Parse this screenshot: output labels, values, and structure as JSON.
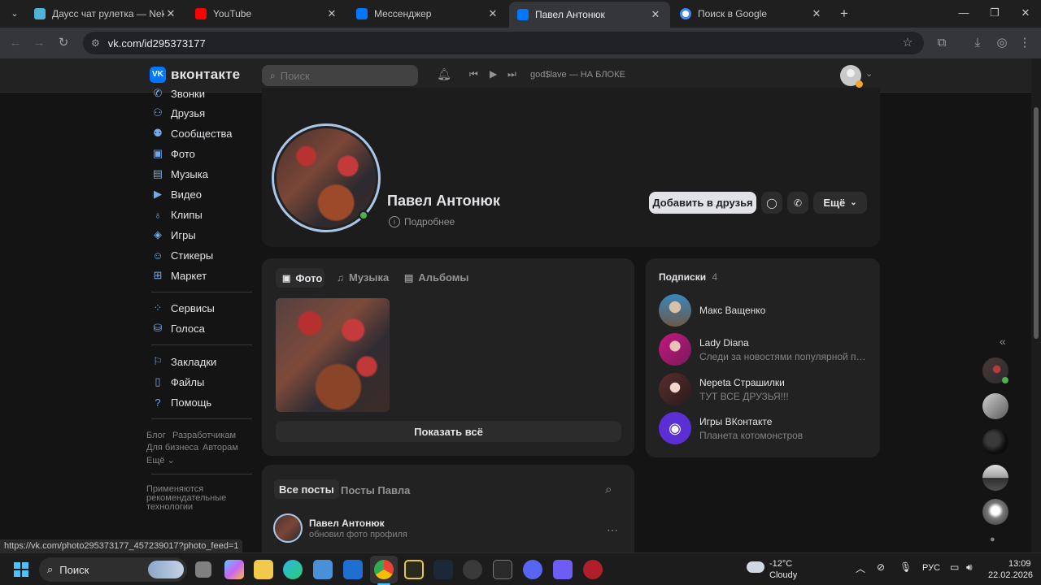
{
  "browser": {
    "tabs": [
      {
        "title": "Даусс чат рулетка — Nekto",
        "color": "#4fb3d9"
      },
      {
        "title": "YouTube",
        "color": "#ff0000"
      },
      {
        "title": "Мессенджер",
        "color": "#0077ff"
      },
      {
        "title": "Павел Антонюк",
        "color": "#0077ff"
      },
      {
        "title": "Поиск в Google",
        "color": "#4285f4"
      }
    ],
    "url": "vk.com/id295373177",
    "status_url": "https://vk.com/photo295373177_457239017?photo_feed=1"
  },
  "vk": {
    "logo_text": "вконтакте",
    "search_placeholder": "Поиск",
    "player_track": "god$lave — НА БЛОКЕ"
  },
  "menu": {
    "items": [
      "Звонки",
      "Друзья",
      "Сообщества",
      "Фото",
      "Музыка",
      "Видео",
      "Клипы",
      "Игры",
      "Стикеры",
      "Маркет"
    ],
    "items2": [
      "Сервисы",
      "Голоса"
    ],
    "items3": [
      "Закладки",
      "Файлы",
      "Помощь"
    ],
    "footer": {
      "blog": "Блог",
      "developers": "Разработчикам",
      "business": "Для бизнеса",
      "authors": "Авторам",
      "more": "Ещё",
      "recommend_1": "Применяются",
      "recommend_2": "рекомендательные",
      "recommend_3": "технологии"
    }
  },
  "profile": {
    "name": "Павел Антонюк",
    "more_info": "Подробнее",
    "add_friend": "Добавить в друзья",
    "more": "Ещё"
  },
  "media": {
    "tabs": [
      "Фото",
      "Музыка",
      "Альбомы"
    ],
    "show_all": "Показать всё"
  },
  "subscriptions": {
    "title": "Подписки",
    "count": "4",
    "items": [
      {
        "name": "Макс Ващенко",
        "desc": ""
      },
      {
        "name": "Lady Diana",
        "desc": "Следи за новостями популярной певи..."
      },
      {
        "name": "Nepeta Страшилки",
        "desc": "ТУТ ВСЕ ДРУЗЬЯ!!!"
      },
      {
        "name": "Игры ВКонтакте",
        "desc": "Планета котомонстров"
      }
    ]
  },
  "posts": {
    "tab_all": "Все посты",
    "tab_own": "Посты Павла",
    "author": "Павел Антонюк",
    "action": "обновил фото профиля"
  },
  "taskbar": {
    "search": "Поиск",
    "weather_temp": "-12°C",
    "weather_desc": "Cloudy",
    "lang": "РУС",
    "time": "13:09",
    "date": "22.02.2026"
  }
}
